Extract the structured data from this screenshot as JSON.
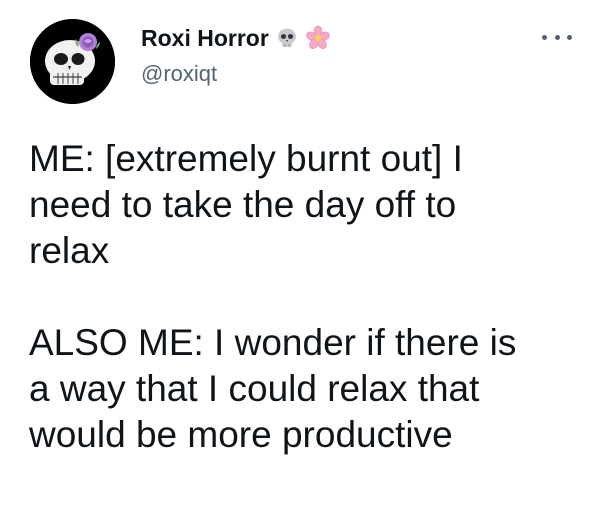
{
  "author": {
    "display_name": "Roxi Horror",
    "handle": "@roxiqt",
    "name_emoji": [
      "skull-icon",
      "cherry-blossom-icon"
    ]
  },
  "menu": {
    "icon": "more-options-icon"
  },
  "tweet": {
    "paragraphs": [
      "ME: [extremely burnt out] I\nneed to take the day off to\nrelax",
      "ALSO ME: I wonder if there is\na way that I could relax that\nwould be more productive"
    ]
  },
  "colors": {
    "text": "#0f1419",
    "secondary": "#536471",
    "background": "#ffffff"
  }
}
